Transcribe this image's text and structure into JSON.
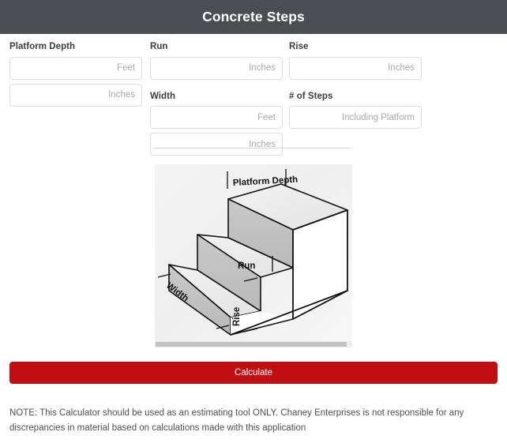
{
  "header": {
    "title": "Concrete Steps",
    "bg_color": "#4a4d52",
    "text_color": "#ffffff"
  },
  "form": {
    "columns": [
      {
        "name": "platform-depth",
        "label": "Platform Depth",
        "inputs": [
          {
            "name": "platform-depth-feet",
            "placeholder": "Feet",
            "value": ""
          },
          {
            "name": "platform-depth-inches",
            "placeholder": "Inches",
            "value": ""
          }
        ]
      },
      {
        "name": "run",
        "label": "Run",
        "inputs": [
          {
            "name": "run-inches",
            "placeholder": "Inches",
            "value": ""
          }
        ],
        "label2": "Width",
        "inputs2": [
          {
            "name": "width-feet",
            "placeholder": "Feet",
            "value": ""
          },
          {
            "name": "width-inches",
            "placeholder": "Inches",
            "value": ""
          }
        ]
      },
      {
        "name": "rise",
        "label": "Rise",
        "inputs": [
          {
            "name": "rise-inches",
            "placeholder": "Inches",
            "value": ""
          }
        ],
        "label2": "# of Steps",
        "inputs2": [
          {
            "name": "number-of-steps",
            "placeholder": "Including Platform",
            "value": ""
          }
        ]
      }
    ]
  },
  "diagram": {
    "name": "concrete-steps-illustration",
    "labels": {
      "platform_depth": "Platform Depth",
      "run": "Run",
      "rise": "Rise",
      "width": "Width"
    }
  },
  "actions": {
    "calculate_label": "Calculate",
    "calculate_color": "#c10e13"
  },
  "footer": {
    "note": "NOTE: This Calculator should be used as an estimating tool ONLY. Chaney Enterprises is not responsible for any discrepancies in material based on calculations made with this application"
  }
}
